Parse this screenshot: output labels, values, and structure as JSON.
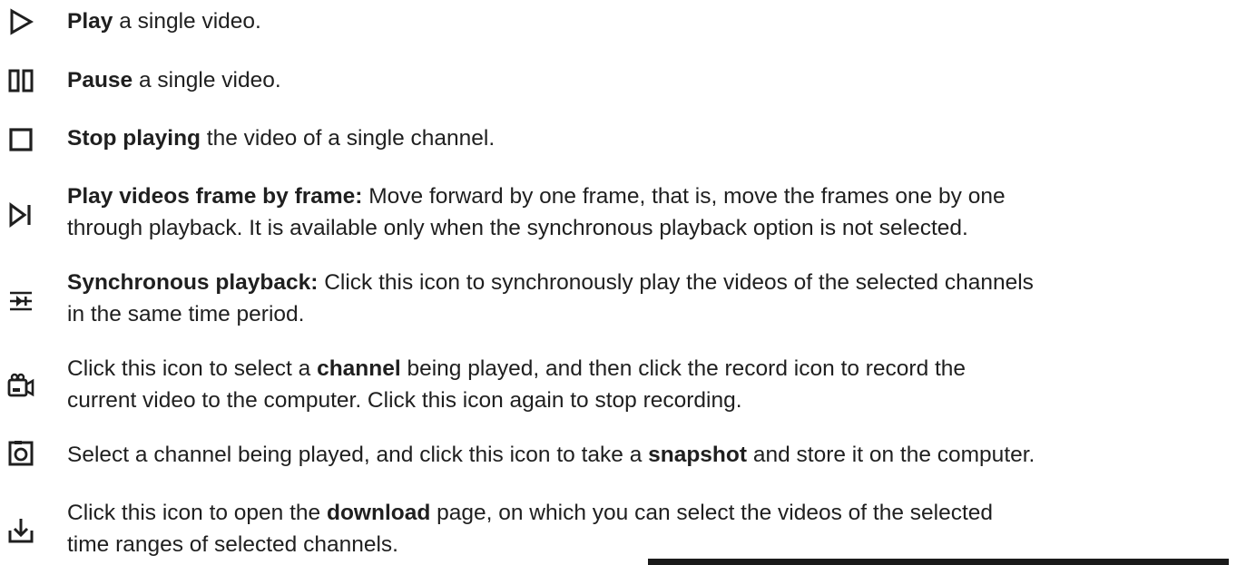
{
  "items": [
    {
      "icon": "play-icon",
      "bold": "Play",
      "text": " a single video."
    },
    {
      "icon": "pause-icon",
      "bold": "Pause",
      "text": " a single video."
    },
    {
      "icon": "stop-icon",
      "bold": "Stop playing",
      "text": " the video of a single channel."
    },
    {
      "icon": "frame-by-frame-icon",
      "bold": "Play videos frame by frame:",
      "line1": " Move forward by one frame, that is, move the frames one by one",
      "line2": "through playback. It is available only when the synchronous playback option is not selected."
    },
    {
      "icon": "synchronous-playback-icon",
      "bold": "Synchronous playback:",
      "line1": " Click this icon to synchronously play the videos of the selected channels",
      "line2": "in the same time period."
    },
    {
      "icon": "record-icon",
      "pre": "Click this icon to select a ",
      "bold": "channel",
      "post": " being played, and then click the record icon to record the",
      "line2": "current video to the computer. Click this icon again to stop recording."
    },
    {
      "icon": "snapshot-icon",
      "pre": "Select a channel being played, and click this icon to take a ",
      "bold": "snapshot",
      "post": " and store it on the computer."
    },
    {
      "icon": "download-icon",
      "pre": "Click this icon to open the ",
      "bold": "download",
      "post": " page, on which you can select the videos of the selected",
      "line2": "time ranges of selected channels."
    }
  ]
}
